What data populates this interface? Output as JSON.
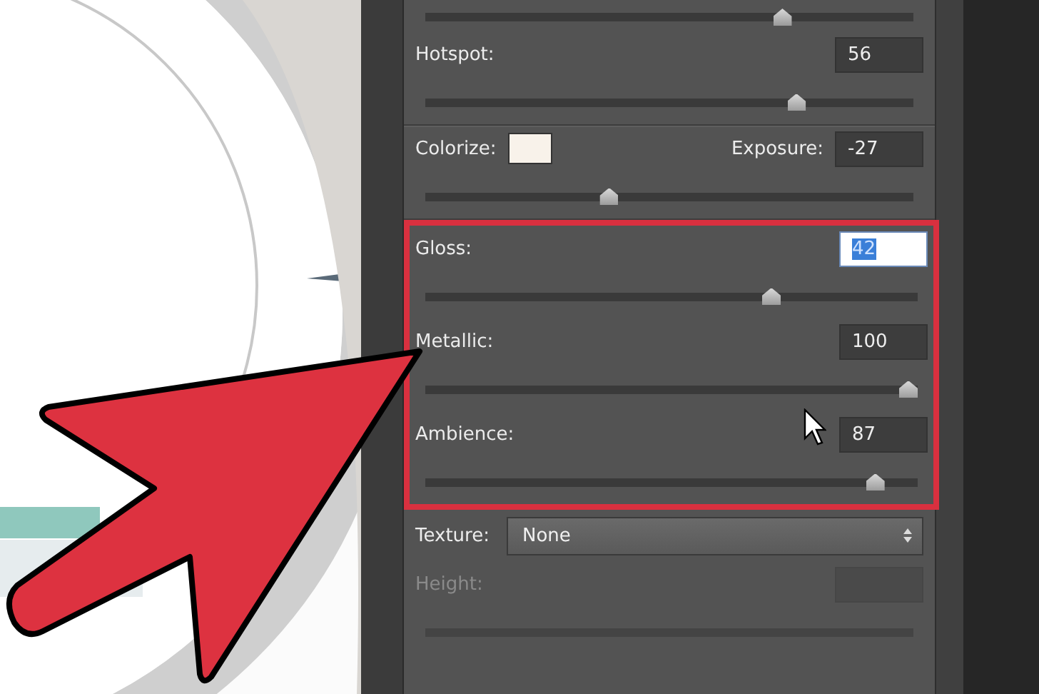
{
  "sections": [
    {
      "rows": [
        {
          "kind": "slider",
          "disabled": false,
          "level": 0.74
        },
        {
          "kind": "value",
          "label": "Hotspot:",
          "value": "56",
          "value_selected": false,
          "disabled": false,
          "level": 0.77
        }
      ]
    },
    {
      "rows": [
        {
          "kind": "color",
          "label": "Colorize:",
          "color": "#f8f2ea",
          "label2": "Exposure:",
          "value": "-27",
          "value_selected": false,
          "disabled": false,
          "level": 0.37
        }
      ]
    }
  ],
  "highlight_frame": {
    "rows": [
      {
        "kind": "value",
        "label": "Gloss:",
        "value": "42",
        "value_selected": true,
        "disabled": false,
        "level": 0.71
      },
      {
        "kind": "value",
        "label": "Metallic:",
        "value": "100",
        "value_selected": false,
        "disabled": false,
        "level": 1.0
      },
      {
        "kind": "value",
        "label": "Ambience:",
        "value": "87",
        "value_selected": false,
        "disabled": false,
        "level": 0.93
      }
    ]
  },
  "lower_section": {
    "rows": [
      {
        "kind": "select",
        "label": "Texture:",
        "value": "None",
        "disabled": false
      },
      {
        "kind": "value",
        "label": "Height:",
        "disabled": true
      }
    ]
  }
}
